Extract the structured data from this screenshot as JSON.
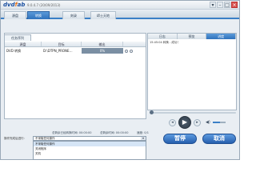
{
  "app": {
    "logo_text": "dvdfab",
    "version": "9.0.4.7 (20/09/2013)"
  },
  "tabs": [
    {
      "label": "源盘",
      "active": false
    },
    {
      "label": "转换",
      "active": true
    },
    {
      "label": "刻录",
      "active": false
    },
    {
      "label": "缔士天地",
      "active": false
    }
  ],
  "left_panel": {
    "label": "任务序列",
    "columns": [
      "源盘",
      "目标",
      "输出"
    ],
    "rows": [
      {
        "source": "DVD 转换",
        "target": "D:\\DTPN_PRONE…",
        "status": "0%"
      }
    ]
  },
  "right_panel": {
    "tabs": [
      {
        "label": "日志",
        "active": false
      },
      {
        "label": "预览",
        "active": false
      },
      {
        "label": "进度",
        "active": true
      }
    ],
    "log": [
      "15:45:04 转换 - 成功！"
    ]
  },
  "player": {
    "prev_icon": "skip-back-icon",
    "play_icon": "play-icon",
    "next_icon": "skip-forward-icon",
    "volume_icon": "speaker-icon"
  },
  "info": {
    "elapsed": "总剩余已经转换时间: 00:00:00",
    "remaining": "总剩余时间: 00:00:00",
    "speed": "速度: 0/1"
  },
  "after_done": {
    "label": "操作完成后进行:",
    "selected": "不采取任何操作",
    "options": [
      "不采取任何操作",
      "关闭程序",
      "关机"
    ]
  },
  "buttons": {
    "pause": "暂停",
    "cancel": "取消"
  },
  "colors": {
    "accent": "#2f72bc",
    "panel_border": "#a7b6c4"
  }
}
